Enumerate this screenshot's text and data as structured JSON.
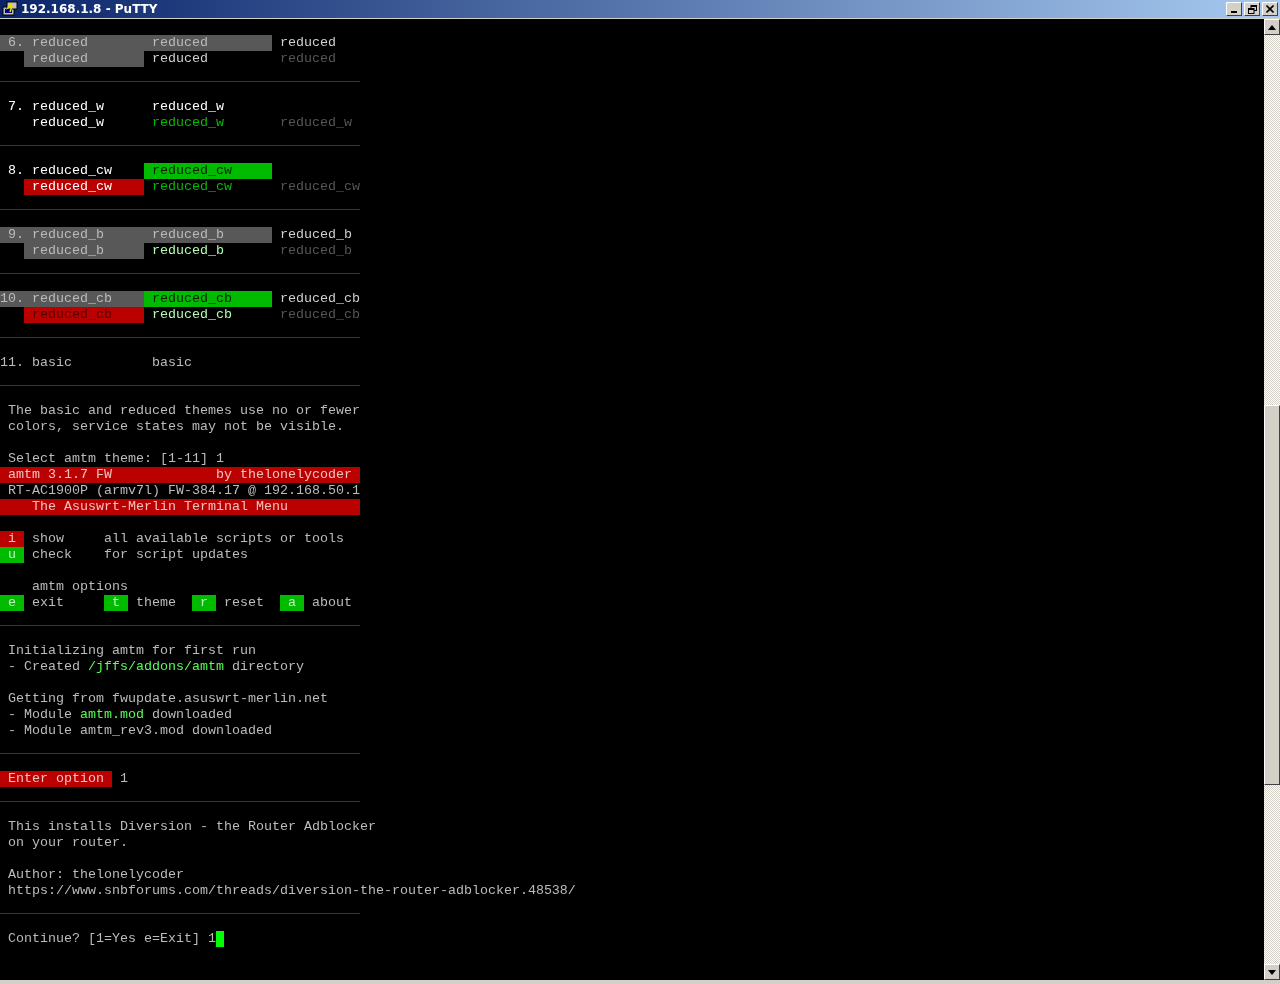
{
  "window": {
    "title": "192.168.1.8 - PuTTY"
  },
  "terminal": {
    "lines": [
      {
        "kind": "blank"
      },
      {
        "kind": "theme",
        "cells": [
          {
            "text": " 6. reduced",
            "kind": "inverse"
          },
          {
            "text": "reduced",
            "kind": "inverse"
          },
          {
            "text": "reduced",
            "kind": "soft"
          }
        ]
      },
      {
        "kind": "theme-cont",
        "cells": [
          {
            "text": "reduced",
            "kind": "inverse"
          },
          {
            "text": "reduced",
            "kind": "soft"
          },
          {
            "text": "reduced",
            "kind": "faint"
          }
        ]
      },
      {
        "kind": "rule"
      },
      {
        "kind": "blank"
      },
      {
        "kind": "theme",
        "cells": [
          {
            "text": " 7. reduced_w",
            "kind": "bright"
          },
          {
            "text": "reduced_w",
            "kind": "bright"
          }
        ]
      },
      {
        "kind": "theme-cont",
        "cells": [
          {
            "text": "reduced_w",
            "kind": "bright"
          },
          {
            "text": "reduced_w",
            "kind": "success"
          },
          {
            "text": "reduced_w",
            "kind": "faint"
          }
        ]
      },
      {
        "kind": "rule"
      },
      {
        "kind": "blank"
      },
      {
        "kind": "theme",
        "cells": [
          {
            "text": " 8. reduced_cw",
            "kind": "bright"
          },
          {
            "text": "reduced_cw",
            "kind": "success-bar"
          }
        ]
      },
      {
        "kind": "theme-cont",
        "cells": [
          {
            "text": "reduced_cw",
            "kind": "alert-bar-strong"
          },
          {
            "text": "reduced_cw",
            "kind": "success"
          },
          {
            "text": "reduced_cw",
            "kind": "faint"
          }
        ]
      },
      {
        "kind": "rule"
      },
      {
        "kind": "blank"
      },
      {
        "kind": "theme",
        "cells": [
          {
            "text": " 9. reduced_b",
            "kind": "inverse"
          },
          {
            "text": "reduced_b",
            "kind": "inverse"
          },
          {
            "text": "reduced_b",
            "kind": "soft"
          }
        ]
      },
      {
        "kind": "theme-cont",
        "cells": [
          {
            "text": "reduced_b",
            "kind": "inverse"
          },
          {
            "text": "reduced_b",
            "kind": "success-light"
          },
          {
            "text": "reduced_b",
            "kind": "faint"
          }
        ]
      },
      {
        "kind": "rule"
      },
      {
        "kind": "blank"
      },
      {
        "kind": "theme",
        "cells": [
          {
            "text": "10. reduced_cb",
            "kind": "inverse"
          },
          {
            "text": "reduced_cb",
            "kind": "success-bar"
          },
          {
            "text": "reduced_cb",
            "kind": "soft"
          }
        ]
      },
      {
        "kind": "theme-cont",
        "cells": [
          {
            "text": "reduced_cb",
            "kind": "alert-bar-muted"
          },
          {
            "text": "reduced_cb",
            "kind": "success-light"
          },
          {
            "text": "reduced_cb",
            "kind": "faint"
          }
        ]
      },
      {
        "kind": "rule"
      },
      {
        "kind": "blank"
      },
      {
        "kind": "theme",
        "cells": [
          {
            "text": "11. basic",
            "kind": "plain"
          },
          {
            "text": "basic",
            "kind": "plain"
          }
        ]
      },
      {
        "kind": "rule"
      },
      {
        "kind": "blank"
      },
      {
        "kind": "text",
        "segments": [
          {
            "text": " The basic and reduced themes use no or fewer",
            "kind": "plain"
          }
        ]
      },
      {
        "kind": "text",
        "segments": [
          {
            "text": " colors, service states may not be visible.",
            "kind": "plain"
          }
        ]
      },
      {
        "kind": "blank"
      },
      {
        "kind": "text",
        "segments": [
          {
            "text": " Select amtm theme: [1-11] 1",
            "kind": "plain"
          }
        ]
      },
      {
        "kind": "text",
        "segments": [
          {
            "text": " amtm 3.1.7 FW            ",
            "kind": "alert-bar"
          },
          {
            "text": " by thelonelycoder ",
            "kind": "alert-bar"
          }
        ]
      },
      {
        "kind": "text",
        "segments": [
          {
            "text": " RT-AC1900P (armv7l) FW-384.17 @ 192.168.50.1",
            "kind": "plain"
          }
        ]
      },
      {
        "kind": "text",
        "segments": [
          {
            "text": "    The Asuswrt-Merlin Terminal Menu         ",
            "kind": "alert-bar"
          }
        ]
      },
      {
        "kind": "blank"
      },
      {
        "kind": "text",
        "segments": [
          {
            "text": " i ",
            "kind": "alert-bar"
          },
          {
            "text": " show",
            "kind": "plain"
          },
          {
            "text": "     all available scripts or tools",
            "kind": "plain"
          }
        ]
      },
      {
        "kind": "text",
        "segments": [
          {
            "text": " u ",
            "kind": "key"
          },
          {
            "text": " check",
            "kind": "plain"
          },
          {
            "text": "    for script updates",
            "kind": "plain"
          }
        ]
      },
      {
        "kind": "blank"
      },
      {
        "kind": "text",
        "segments": [
          {
            "text": "    amtm options",
            "kind": "plain"
          }
        ]
      },
      {
        "kind": "text",
        "segments": [
          {
            "text": " e ",
            "kind": "key"
          },
          {
            "text": " exit     ",
            "kind": "plain"
          },
          {
            "text": " t ",
            "kind": "key"
          },
          {
            "text": " theme  ",
            "kind": "plain"
          },
          {
            "text": " r ",
            "kind": "key"
          },
          {
            "text": " reset  ",
            "kind": "plain"
          },
          {
            "text": " a ",
            "kind": "key"
          },
          {
            "text": " about",
            "kind": "plain"
          }
        ]
      },
      {
        "kind": "rule"
      },
      {
        "kind": "blank"
      },
      {
        "kind": "text",
        "segments": [
          {
            "text": " Initializing amtm for first run",
            "kind": "plain"
          }
        ]
      },
      {
        "kind": "text",
        "segments": [
          {
            "text": " - Created ",
            "kind": "plain"
          },
          {
            "text": "/jffs/addons/amtm",
            "kind": "path"
          },
          {
            "text": " directory",
            "kind": "plain"
          }
        ]
      },
      {
        "kind": "blank"
      },
      {
        "kind": "text",
        "segments": [
          {
            "text": " Getting from fwupdate.asuswrt-merlin.net",
            "kind": "plain"
          }
        ]
      },
      {
        "kind": "text",
        "segments": [
          {
            "text": " - Module ",
            "kind": "plain"
          },
          {
            "text": "amtm.mod",
            "kind": "path"
          },
          {
            "text": " downloaded",
            "kind": "plain"
          }
        ]
      },
      {
        "kind": "text",
        "segments": [
          {
            "text": " - Module amtm_rev3.mod downloaded",
            "kind": "plain"
          }
        ]
      },
      {
        "kind": "rule"
      },
      {
        "kind": "blank"
      },
      {
        "kind": "text",
        "segments": [
          {
            "text": " Enter option ",
            "kind": "alert-bar"
          },
          {
            "text": " 1",
            "kind": "plain"
          }
        ]
      },
      {
        "kind": "rule"
      },
      {
        "kind": "blank"
      },
      {
        "kind": "text",
        "segments": [
          {
            "text": " This installs Diversion - the Router Adblocker",
            "kind": "plain"
          }
        ]
      },
      {
        "kind": "text",
        "segments": [
          {
            "text": " on your router.",
            "kind": "plain"
          }
        ]
      },
      {
        "kind": "blank"
      },
      {
        "kind": "text",
        "segments": [
          {
            "text": " Author: thelonelycoder",
            "kind": "plain"
          }
        ]
      },
      {
        "kind": "text",
        "segments": [
          {
            "text": " https://www.snbforums.com/threads/diversion-the-router-adblocker.48538/",
            "kind": "plain"
          }
        ]
      },
      {
        "kind": "rule"
      },
      {
        "kind": "blank"
      },
      {
        "kind": "prompt",
        "segments": [
          {
            "text": " Continue? [1=Yes e=Exit] 1",
            "kind": "plain"
          }
        ]
      }
    ]
  }
}
